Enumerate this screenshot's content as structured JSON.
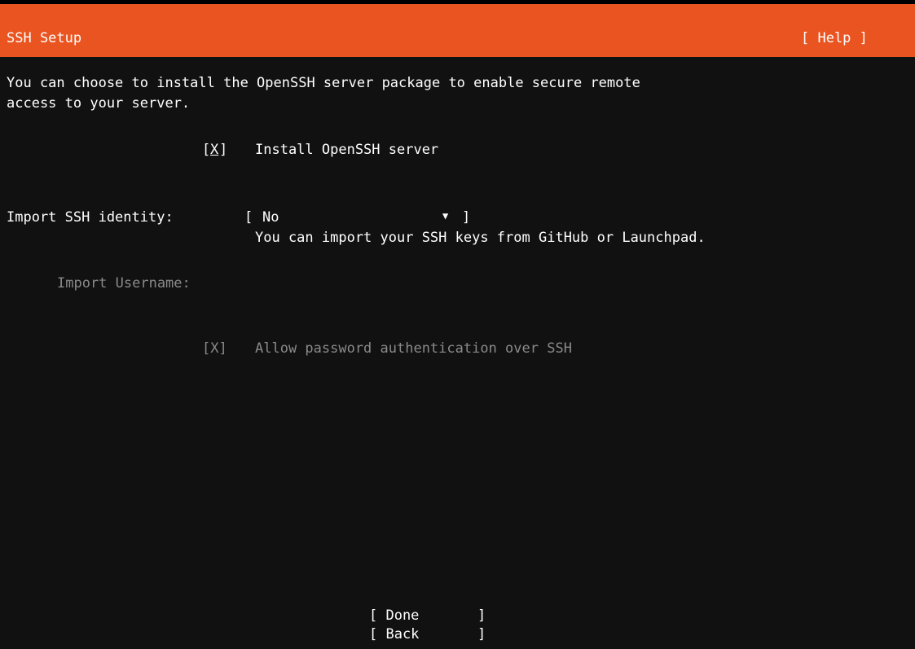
{
  "header": {
    "title": "SSH Setup",
    "help_label": "[ Help ]"
  },
  "intro": {
    "line1": "You can choose to install the OpenSSH server package to enable secure remote",
    "line2": "access to your server."
  },
  "install_openssh": {
    "open_bracket": "[",
    "mark": "X",
    "close_bracket": "]",
    "label": "Install OpenSSH server"
  },
  "import_identity": {
    "label": "Import SSH identity:",
    "select_open": "[",
    "selected_value": "No",
    "arrow": "▼",
    "select_close": "]",
    "hint": "You can import your SSH keys from GitHub or Launchpad."
  },
  "import_username": {
    "label": "Import Username:"
  },
  "allow_password": {
    "checkbox": "[X]",
    "label": "Allow password authentication over SSH"
  },
  "footer": {
    "done_label": "[ Done       ]",
    "back_label": "[ Back       ]"
  },
  "colors": {
    "accent": "#e95420",
    "background": "#111111",
    "disabled_text": "#8a8a8a"
  }
}
